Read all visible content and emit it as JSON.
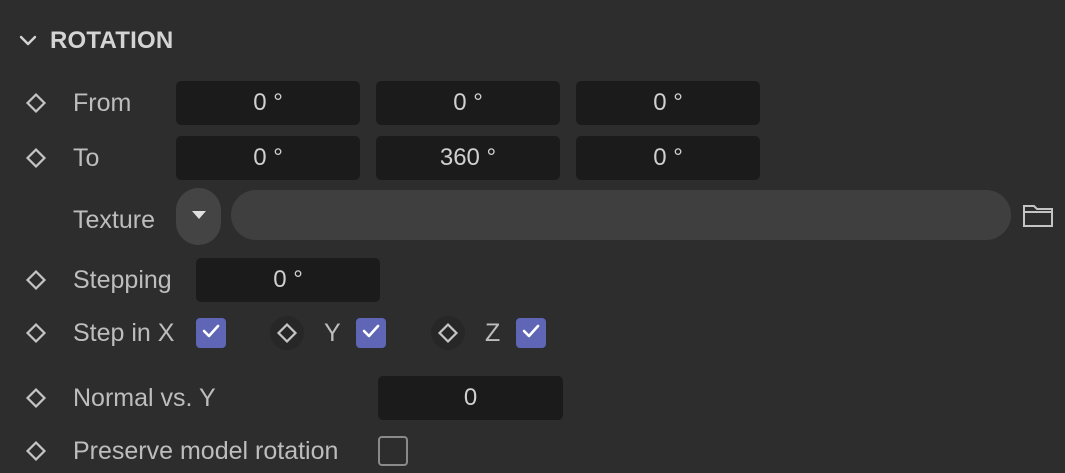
{
  "section": {
    "title": "ROTATION",
    "expanded": true
  },
  "rows": {
    "from": {
      "label": "From",
      "values": [
        "0 °",
        "0 °",
        "0 °"
      ]
    },
    "to": {
      "label": "To",
      "values": [
        "0 °",
        "360 °",
        "0 °"
      ]
    },
    "texture": {
      "label": "Texture",
      "value": ""
    },
    "stepping": {
      "label": "Stepping",
      "value": "0 °"
    },
    "step_in": {
      "label": "Step in X",
      "x_checked": true,
      "y_label": "Y",
      "y_checked": true,
      "z_label": "Z",
      "z_checked": true
    },
    "normal_vs_y": {
      "label": "Normal vs. Y",
      "value": "0"
    },
    "preserve_model_rotation": {
      "label": "Preserve model rotation",
      "checked": false
    }
  },
  "icons": {
    "section_toggle": "chevron-down-icon",
    "keyframe": "diamond-icon",
    "texture_dropdown": "caret-down-icon",
    "texture_browse": "folder-icon",
    "checkbox_checked": "check-icon"
  },
  "colors": {
    "background": "#2d2d2d",
    "field": "#1b1b1b",
    "checkbox_accent": "#5f66b5",
    "text": "#bdbdbd"
  }
}
